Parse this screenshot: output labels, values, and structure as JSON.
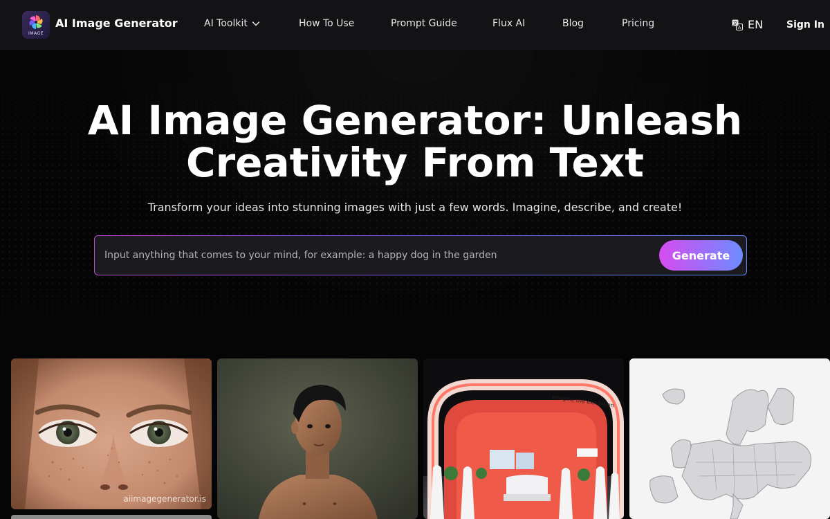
{
  "header": {
    "logo_text": "IMAGE",
    "brand": "AI Image Generator",
    "nav": [
      {
        "label": "AI Toolkit",
        "has_dropdown": true
      },
      {
        "label": "How To Use"
      },
      {
        "label": "Prompt Guide"
      },
      {
        "label": "Flux AI"
      },
      {
        "label": "Blog"
      },
      {
        "label": "Pricing"
      }
    ],
    "language": "EN",
    "sign_in": "Sign In"
  },
  "hero": {
    "title_line1": "AI Image Generator: Unleash",
    "title_line2": "Creativity From Text",
    "subtitle": "Transform your ideas into stunning images with just a few words. Imagine, describe, and create!",
    "input_placeholder": "Input anything that comes to your mind, for example: a happy dog in the garden",
    "input_value": "",
    "generate_label": "Generate"
  },
  "gallery": {
    "watermark": "aiimagegenerator.is",
    "booth_sign": "Imagine the exhibition"
  },
  "colors": {
    "background": "#050505",
    "header_bg": "#131316",
    "accent_start": "#d64bf0",
    "accent_end": "#6d8cff"
  }
}
